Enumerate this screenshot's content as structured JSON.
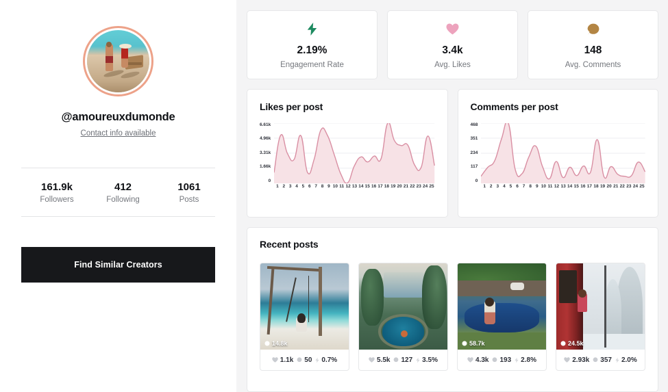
{
  "profile": {
    "avatar_alt": "beach-couple-photo",
    "handle": "@amoureuxdumonde",
    "contact_link": "Contact info available",
    "stats": [
      {
        "value": "161.9k",
        "label": "Followers"
      },
      {
        "value": "412",
        "label": "Following"
      },
      {
        "value": "1061",
        "label": "Posts"
      }
    ],
    "cta_label": "Find Similar Creators"
  },
  "metrics": [
    {
      "icon": "lightning-icon",
      "color": "#1d8a60",
      "value": "2.19%",
      "label": "Engagement Rate"
    },
    {
      "icon": "heart-icon",
      "color": "#eda3bd",
      "value": "3.4k",
      "label": "Avg. Likes"
    },
    {
      "icon": "comment-bubble-icon",
      "color": "#b38544",
      "value": "148",
      "label": "Avg. Comments"
    }
  ],
  "charts": [
    {
      "title": "Likes per post",
      "chart_data": {
        "type": "area",
        "title": "Likes per post",
        "xlabel": "",
        "ylabel": "",
        "ylim": [
          0,
          6610
        ],
        "grid": true,
        "legend": "none",
        "line_color": "#d98fa3",
        "fill_color": "#f7e2e6",
        "yticks": [
          0,
          1660,
          3310,
          4960,
          6610
        ],
        "ytick_labels": [
          "0",
          "1.66k",
          "3.31k",
          "4.96k",
          "6.61k"
        ],
        "categories": [
          1,
          2,
          3,
          4,
          5,
          6,
          7,
          8,
          9,
          10,
          11,
          12,
          13,
          14,
          15,
          16,
          17,
          18,
          19,
          20,
          21,
          22,
          23,
          24,
          25
        ],
        "xtick_labels": [
          "1",
          "2",
          "3",
          "4",
          "5",
          "6",
          "7",
          "8",
          "9",
          "10",
          "11",
          "12",
          "13",
          "14",
          "15",
          "16",
          "17",
          "18",
          "19",
          "20",
          "21",
          "22",
          "23",
          "24",
          "25"
        ],
        "values": [
          1180,
          5290,
          3280,
          2630,
          5250,
          1200,
          2650,
          5850,
          5250,
          3150,
          1000,
          60,
          1900,
          2900,
          2350,
          3000,
          2700,
          6610,
          4700,
          4150,
          4200,
          2050,
          1750,
          5200,
          1950
        ]
      }
    },
    {
      "title": "Comments per post",
      "chart_data": {
        "type": "area",
        "title": "Comments per post",
        "xlabel": "",
        "ylabel": "",
        "ylim": [
          0,
          468
        ],
        "grid": true,
        "legend": "none",
        "line_color": "#d98fa3",
        "fill_color": "#f7e2e6",
        "yticks": [
          0,
          117,
          234,
          351,
          468
        ],
        "ytick_labels": [
          "0",
          "117",
          "234",
          "351",
          "468"
        ],
        "categories": [
          1,
          2,
          3,
          4,
          5,
          6,
          7,
          8,
          9,
          10,
          11,
          12,
          13,
          14,
          15,
          16,
          17,
          18,
          19,
          20,
          21,
          22,
          23,
          24,
          25
        ],
        "xtick_labels": [
          "1",
          "2",
          "3",
          "4",
          "5",
          "6",
          "7",
          "8",
          "9",
          "10",
          "11",
          "12",
          "13",
          "14",
          "15",
          "16",
          "17",
          "18",
          "19",
          "20",
          "21",
          "22",
          "23",
          "24",
          "25"
        ],
        "values": [
          55,
          125,
          175,
          345,
          468,
          110,
          75,
          205,
          290,
          130,
          35,
          170,
          45,
          125,
          60,
          135,
          85,
          340,
          50,
          130,
          70,
          55,
          60,
          165,
          90
        ]
      }
    }
  ],
  "recent_posts": {
    "title": "Recent posts",
    "items": [
      {
        "thumb": "beach-swing-photo",
        "views": "14.8k",
        "likes": "1.1k",
        "comments": "50",
        "engagement": "0.7%"
      },
      {
        "thumb": "jungle-pool-photo",
        "views": "",
        "likes": "5.5k",
        "comments": "127",
        "engagement": "3.5%"
      },
      {
        "thumb": "pool-drone-photo",
        "views": "58.7k",
        "likes": "4.3k",
        "comments": "193",
        "engagement": "2.8%"
      },
      {
        "thumb": "snow-train-photo",
        "views": "24.5k",
        "likes": "2.93k",
        "comments": "357",
        "engagement": "2.0%"
      }
    ]
  }
}
